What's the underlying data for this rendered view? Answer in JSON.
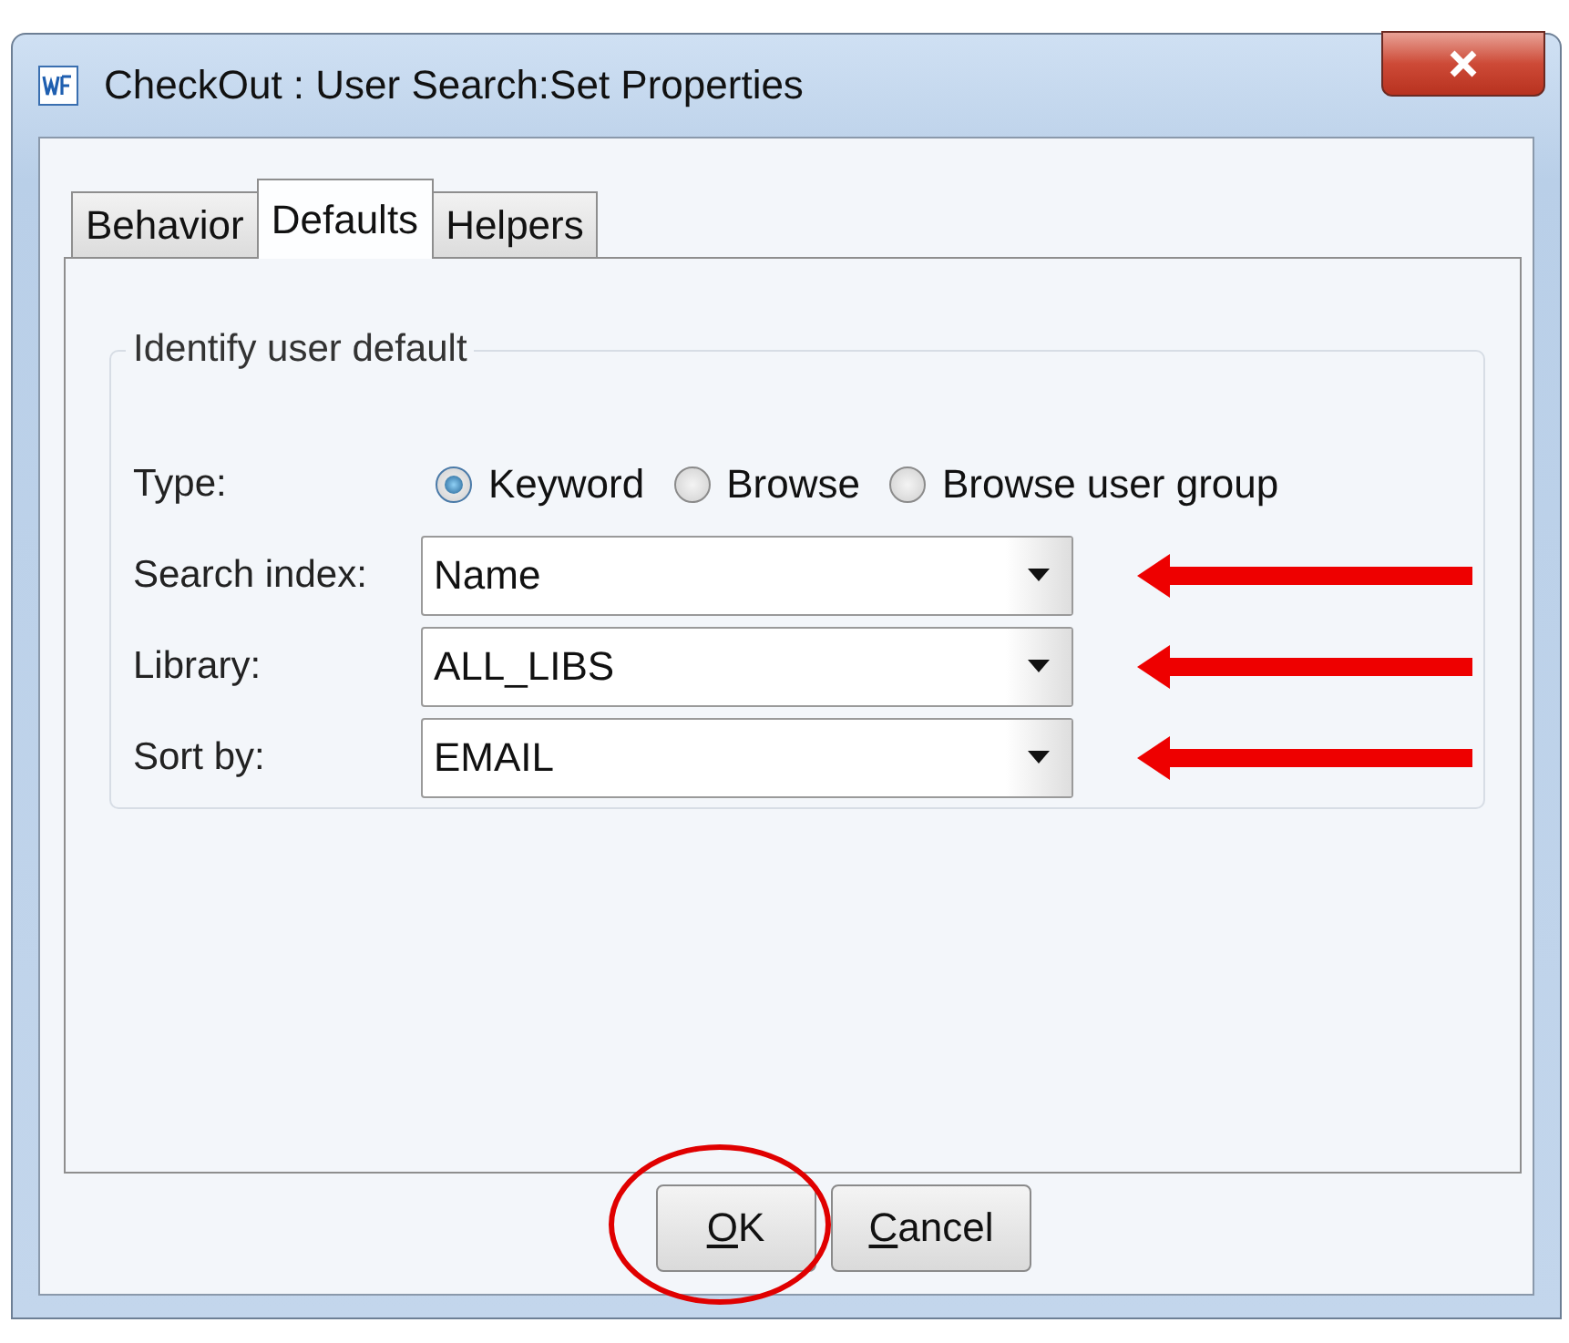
{
  "window": {
    "title": "CheckOut : User Search:Set Properties"
  },
  "tabs": [
    {
      "label": "Behavior",
      "selected": false
    },
    {
      "label": "Defaults",
      "selected": true
    },
    {
      "label": "Helpers",
      "selected": false
    }
  ],
  "group": {
    "title": "Identify user default",
    "type": {
      "label": "Type:",
      "options": [
        {
          "label": "Keyword",
          "selected": true
        },
        {
          "label": "Browse",
          "selected": false
        },
        {
          "label": "Browse user group",
          "selected": false
        }
      ]
    },
    "dropdowns": [
      {
        "label": "Search index:",
        "value": "Name",
        "arrow": true
      },
      {
        "label": "Library:",
        "value": "ALL_LIBS",
        "arrow": true
      },
      {
        "label": "Sort by:",
        "value": "EMAIL",
        "arrow": true
      }
    ]
  },
  "buttons": [
    {
      "label": "OK",
      "mnemonic_underlined": true,
      "circled": true
    },
    {
      "label": "Cancel",
      "mnemonic_underlined": true,
      "circled": false
    }
  ]
}
